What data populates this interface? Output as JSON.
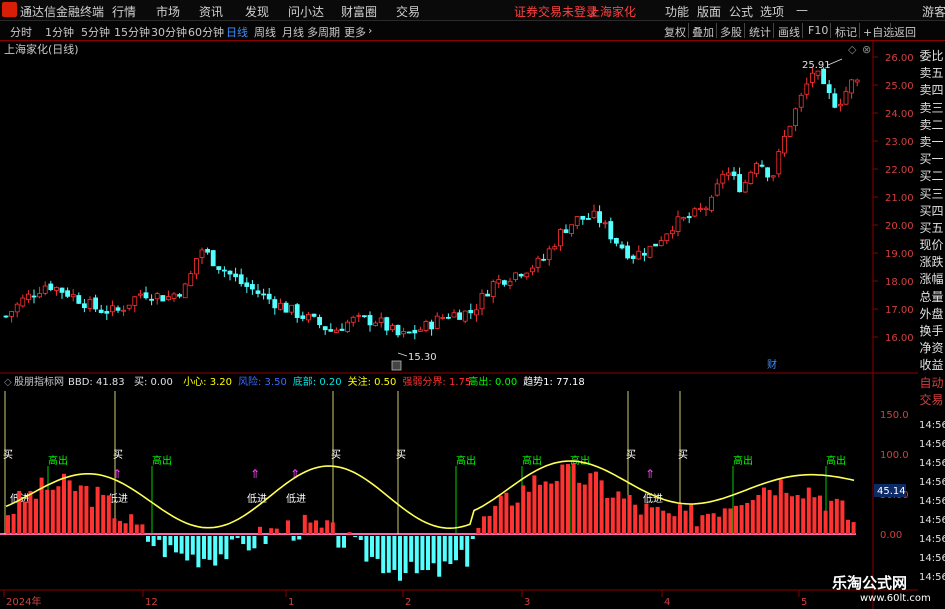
{
  "menubar": {
    "app_title": "通达信金融终端",
    "items": [
      "行情",
      "市场",
      "资讯",
      "发现",
      "问小达",
      "财富圈",
      "交易"
    ],
    "notice": "证券交易未登录",
    "stock": "上海家化",
    "right_items": [
      "功能",
      "版面",
      "公式",
      "选项"
    ],
    "guest": "游客"
  },
  "toolbar": {
    "periods": [
      "分时",
      "1分钟",
      "5分钟",
      "15分钟",
      "30分钟",
      "60分钟",
      "日线",
      "周线",
      "月线",
      "多周期",
      "更多"
    ],
    "active_period": "日线",
    "right_tools": [
      "复权",
      "叠加",
      "多股",
      "统计",
      "画线",
      "F10",
      "标记",
      "+自选",
      "返回"
    ]
  },
  "chart_title": "上海家化(日线)",
  "price_axis": [
    "26.00",
    "25.00",
    "24.00",
    "23.00",
    "22.00",
    "21.00",
    "20.00",
    "19.00",
    "18.00",
    "17.00",
    "16.00"
  ],
  "high_label": "25.91",
  "low_label": "15.30",
  "cai_label": "财",
  "right_panel": [
    "委比",
    "卖五",
    "卖四",
    "卖三",
    "卖二",
    "卖一",
    "买一",
    "买二",
    "买三",
    "买四",
    "买五",
    "现价",
    "涨跌",
    "涨幅",
    "总量",
    "外盘",
    "换手",
    "净资",
    "收益",
    "自动",
    "交易"
  ],
  "right_values": [
    "14:56",
    "14:56",
    "14:56",
    "14:56",
    "14:56",
    "14:56",
    "14:56",
    "14:56",
    "14:56"
  ],
  "indicator": {
    "name": "股朋指标网",
    "params": [
      {
        "label": "BBD:",
        "value": "41.83",
        "color": "#e0e0e0"
      },
      {
        "label": "买:",
        "value": "0.00",
        "color": "#e0e0e0"
      },
      {
        "label": "小心:",
        "value": "3.20",
        "color": "#ffff00"
      },
      {
        "label": "风险:",
        "value": "3.50",
        "color": "#3a6bff"
      },
      {
        "label": "底部:",
        "value": "0.20",
        "color": "#00e5e5"
      },
      {
        "label": "关注:",
        "value": "0.50",
        "color": "#ffff00"
      },
      {
        "label": "强弱分界:",
        "value": "1.75",
        "color": "#ff3030"
      },
      {
        "label": "高出:",
        "value": "0.00",
        "color": "#00ff00"
      },
      {
        "label": "趋势1:",
        "value": "77.18",
        "color": "#ffffff"
      }
    ],
    "axis": [
      "150.0",
      "100.0",
      "50.00",
      "0.00"
    ],
    "current_value": "45.14",
    "buy_label": "买",
    "high_out_label": "高出",
    "low_entry_label": "低进"
  },
  "date_axis": [
    "2024年",
    "12",
    "1",
    "2",
    "3",
    "4",
    "5"
  ],
  "watermark": {
    "name": "乐淘公式网",
    "url": "www.60lt.com"
  },
  "colors": {
    "up": "#ff3232",
    "down": "#54ffff",
    "accent": "#3d8dff",
    "line": "#ffff55"
  }
}
